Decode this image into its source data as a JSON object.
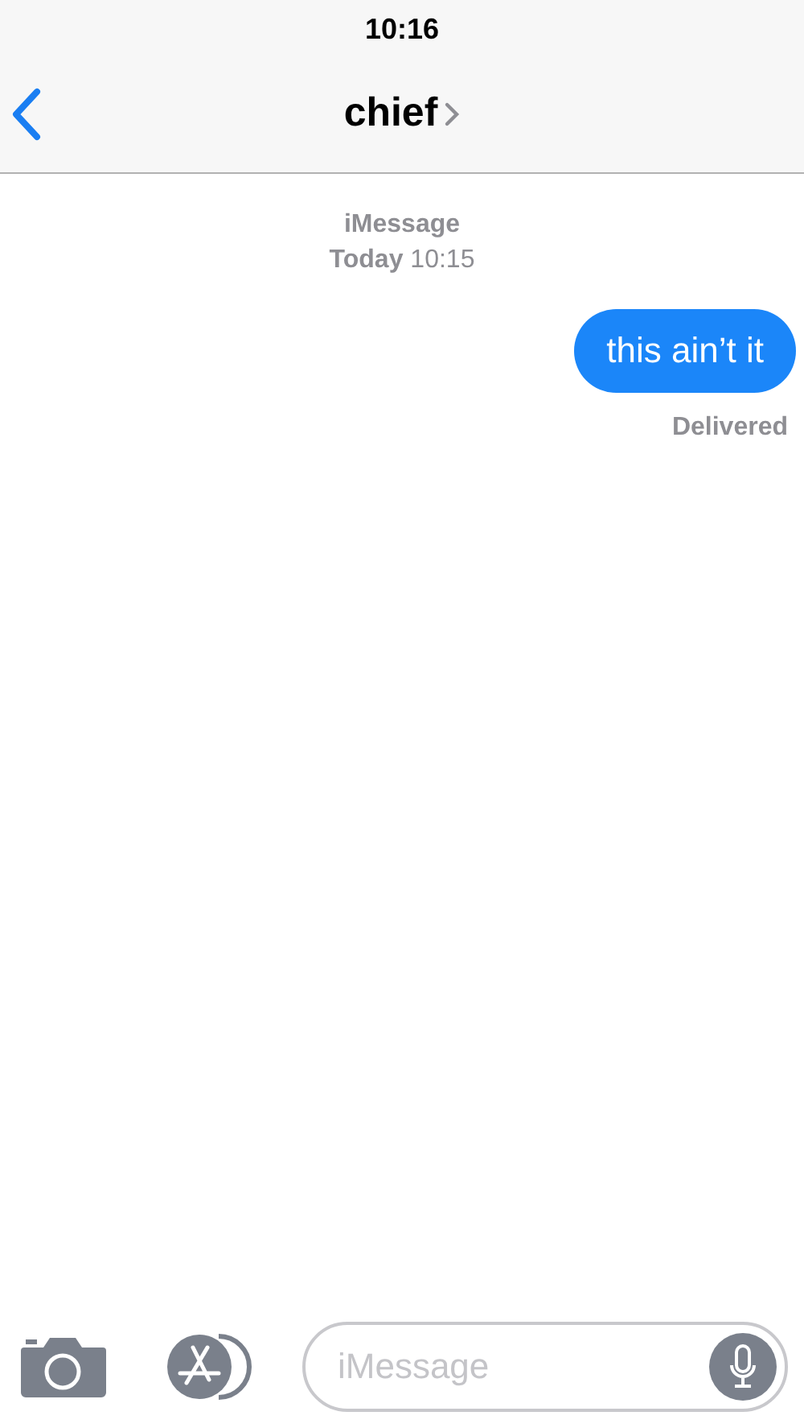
{
  "status_bar": {
    "time": "10:16"
  },
  "nav": {
    "title": "chief"
  },
  "thread_header": {
    "service": "iMessage",
    "day": "Today",
    "time": "10:15"
  },
  "messages": [
    {
      "kind": "sent",
      "text": "this ain’t it",
      "status": "Delivered"
    }
  ],
  "composer": {
    "placeholder": "iMessage"
  }
}
